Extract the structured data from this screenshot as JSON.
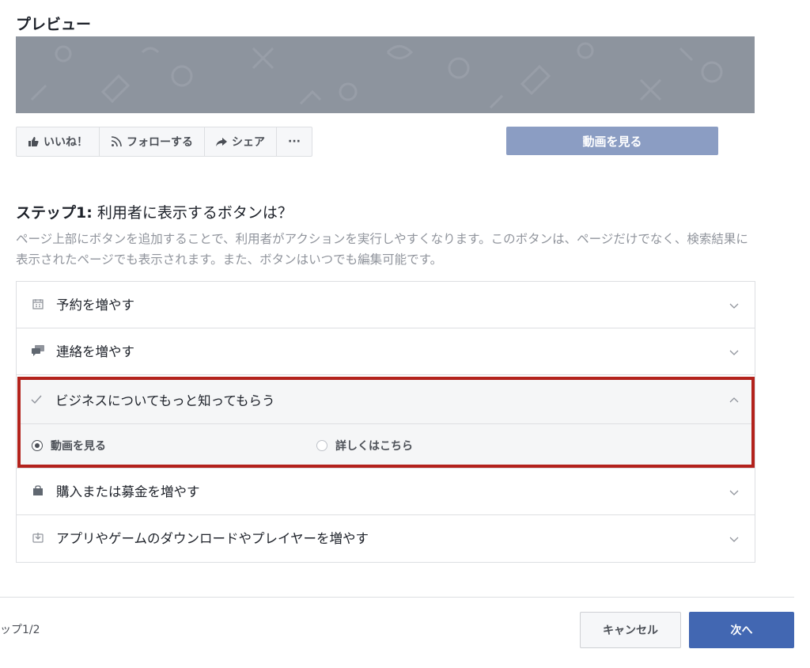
{
  "preview": {
    "title": "プレビュー",
    "actions": [
      {
        "label": "いいね！",
        "icon": "thumbs-up-icon"
      },
      {
        "label": "フォローする",
        "icon": "rss-icon"
      },
      {
        "label": "シェア",
        "icon": "share-arrow-icon"
      },
      {
        "label": "···",
        "icon": "more-icon"
      }
    ],
    "cta_label": "動画を見る"
  },
  "step": {
    "title_bold": "ステップ1:",
    "title_rest": " 利用者に表示するボタンは？",
    "description": "ページ上部にボタンを追加することで、利用者がアクションを実行しやすくなります。このボタンは、ページだけでなく、検索結果に表示されたページでも表示されます。また、ボタンはいつでも編集可能です。"
  },
  "options": [
    {
      "label": "予約を増やす",
      "icon": "calendar-icon"
    },
    {
      "label": "連絡を増やす",
      "icon": "chat-bubbles-icon"
    },
    {
      "label": "ビジネスについてもっと知ってもらう",
      "icon": "checkmark-icon",
      "expanded": true,
      "choices": [
        {
          "label": "動画を見る",
          "selected": true
        },
        {
          "label": "詳しくはこちら",
          "selected": false
        }
      ]
    },
    {
      "label": "購入または募金を増やす",
      "icon": "shopping-bag-icon"
    },
    {
      "label": "アプリやゲームのダウンロードやプレイヤーを増やす",
      "icon": "download-icon"
    }
  ],
  "footer": {
    "step_count": "ップ1/2",
    "cancel_label": "キャンセル",
    "next_label": "次へ"
  },
  "colors": {
    "highlight_border": "#b3221c",
    "primary": "#4267b2",
    "cta_disabled": "#8b9dc3",
    "cover": "#8d949e"
  }
}
